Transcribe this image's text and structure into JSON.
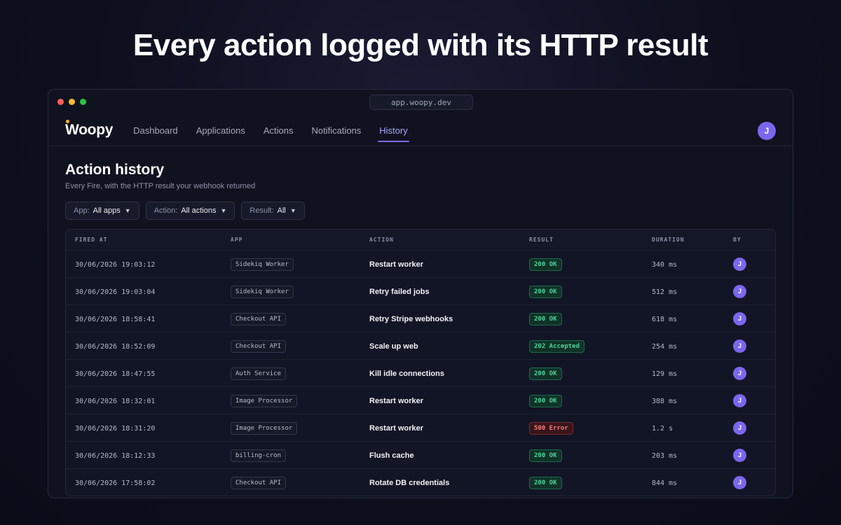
{
  "headline": "Every action logged with its HTTP result",
  "window": {
    "url": "app.woopy.dev"
  },
  "navbar": {
    "logo": "Woopy",
    "items": [
      {
        "label": "Dashboard",
        "active": false
      },
      {
        "label": "Applications",
        "active": false
      },
      {
        "label": "Actions",
        "active": false
      },
      {
        "label": "Notifications",
        "active": false
      },
      {
        "label": "History",
        "active": true
      }
    ],
    "avatar_initial": "J"
  },
  "page": {
    "title": "Action history",
    "subtitle": "Every Fire, with the HTTP result your webhook returned"
  },
  "filters": [
    {
      "label": "App:",
      "value": "All apps"
    },
    {
      "label": "Action:",
      "value": "All actions"
    },
    {
      "label": "Result:",
      "value": "All"
    }
  ],
  "table": {
    "columns": [
      "FIRED AT",
      "APP",
      "ACTION",
      "RESULT",
      "DURATION",
      "BY"
    ],
    "rows": [
      {
        "fired_at": "30/06/2026 19:03:12",
        "app": "Sidekiq Worker",
        "action": "Restart worker",
        "result": "200 OK",
        "status": "ok",
        "duration": "340 ms",
        "by": "J"
      },
      {
        "fired_at": "30/06/2026 19:03:04",
        "app": "Sidekiq Worker",
        "action": "Retry failed jobs",
        "result": "200 OK",
        "status": "ok",
        "duration": "512 ms",
        "by": "J"
      },
      {
        "fired_at": "30/06/2026 18:58:41",
        "app": "Checkout API",
        "action": "Retry Stripe webhooks",
        "result": "200 OK",
        "status": "ok",
        "duration": "618 ms",
        "by": "J"
      },
      {
        "fired_at": "30/06/2026 18:52:09",
        "app": "Checkout API",
        "action": "Scale up web",
        "result": "202 Accepted",
        "status": "ok",
        "duration": "254 ms",
        "by": "J"
      },
      {
        "fired_at": "30/06/2026 18:47:55",
        "app": "Auth Service",
        "action": "Kill idle connections",
        "result": "200 OK",
        "status": "ok",
        "duration": "129 ms",
        "by": "J"
      },
      {
        "fired_at": "30/06/2026 18:32:01",
        "app": "Image Processor",
        "action": "Restart worker",
        "result": "200 OK",
        "status": "ok",
        "duration": "388 ms",
        "by": "J"
      },
      {
        "fired_at": "30/06/2026 18:31:20",
        "app": "Image Processor",
        "action": "Restart worker",
        "result": "500 Error",
        "status": "error",
        "duration": "1.2 s",
        "by": "J"
      },
      {
        "fired_at": "30/06/2026 18:12:33",
        "app": "billing-cron",
        "action": "Flush cache",
        "result": "200 OK",
        "status": "ok",
        "duration": "203 ms",
        "by": "J"
      },
      {
        "fired_at": "30/06/2026 17:58:02",
        "app": "Checkout API",
        "action": "Rotate DB credentials",
        "result": "200 OK",
        "status": "ok",
        "duration": "844 ms",
        "by": "J"
      }
    ]
  },
  "colors": {
    "accent": "#7c6cf6",
    "success": "#4fd39b",
    "error": "#f27d7d",
    "logo_dot": "#f5b82e"
  }
}
